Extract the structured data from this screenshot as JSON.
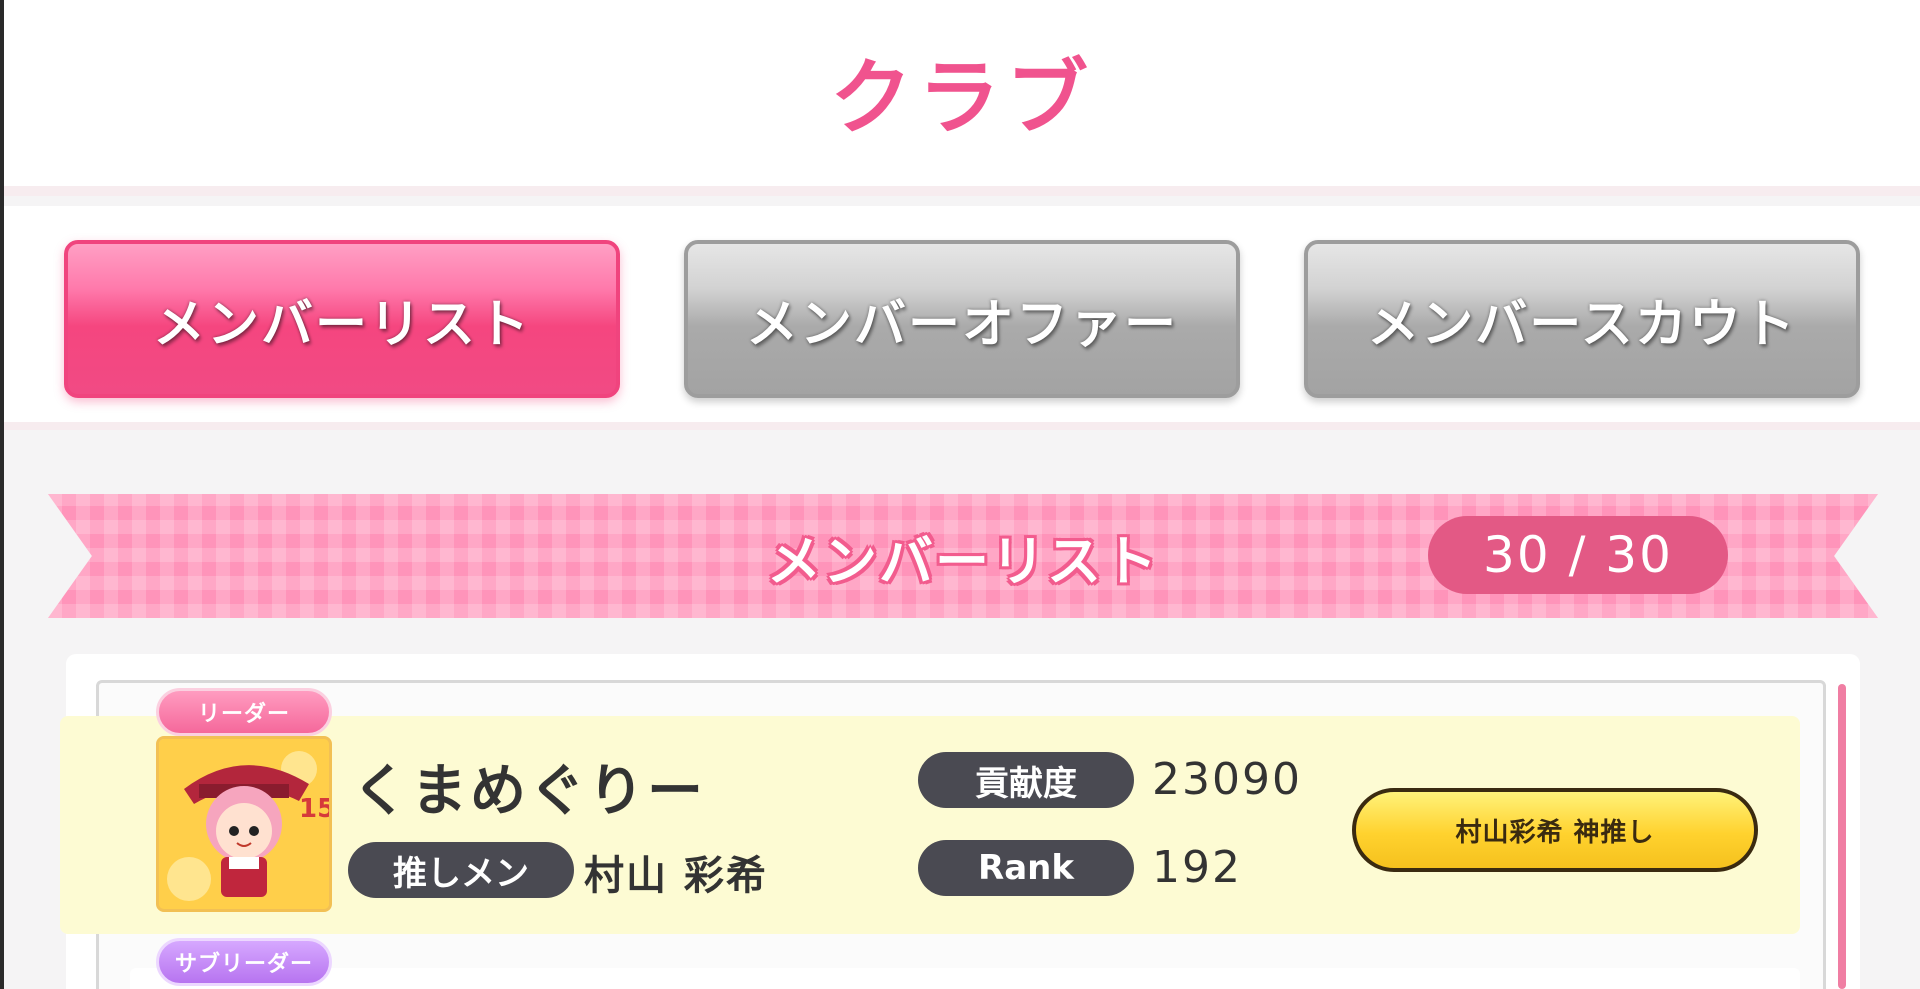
{
  "header": {
    "title": "クラブ"
  },
  "tabs": [
    {
      "label": "メンバーリスト",
      "active": true
    },
    {
      "label": "メンバーオファー",
      "active": false
    },
    {
      "label": "メンバースカウト",
      "active": false
    }
  ],
  "list_header": {
    "title": "メンバーリスト",
    "count": "30 / 30"
  },
  "members": [
    {
      "role": "リーダー",
      "name": "くまめぐりー",
      "oshi_label": "推しメン",
      "oshi_name": "村山 彩希",
      "contribution_label": "貢献度",
      "contribution": "23090",
      "rank_label": "Rank",
      "rank": "192",
      "badge": "村山彩希 神推し",
      "avatar_icon": "member-avatar-icon"
    },
    {
      "role": "サブリーダー"
    }
  ],
  "colors": {
    "accent": "#f0538e",
    "ribbon": "#ff94ba",
    "leader_badge": "#f5689b",
    "subleader_badge": "#b774f0",
    "row_bg": "#fdfbd3",
    "pill_bg": "#4a4a52",
    "god_badge": "#ffd22e"
  }
}
